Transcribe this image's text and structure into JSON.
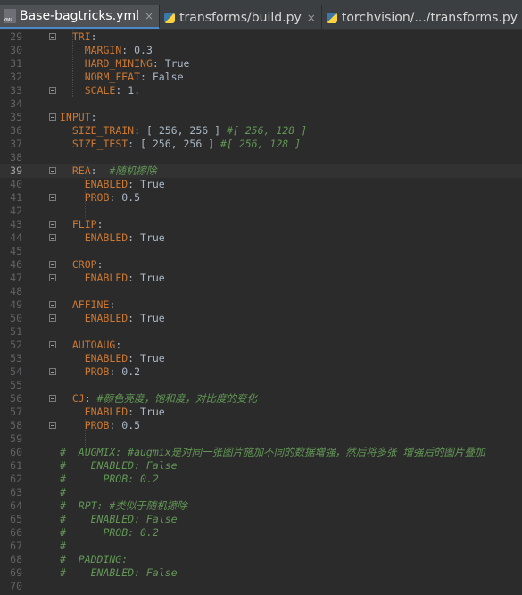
{
  "tabs": [
    {
      "label": "Base-bagtricks.yml",
      "icon": "yaml-file-icon",
      "active": true
    },
    {
      "label": "transforms/build.py",
      "icon": "python-file-icon",
      "active": false
    },
    {
      "label": "torchvision/.../transforms.py",
      "icon": "python-file-icon",
      "active": false
    }
  ],
  "close_glyph": "×",
  "editor": {
    "current_line": 39,
    "lines": [
      {
        "n": "29",
        "indent": "  ",
        "key": "TRI",
        "sep": ":",
        "val": "",
        "comment": "",
        "fold": true
      },
      {
        "n": "30",
        "indent": "    ",
        "key": "MARGIN",
        "sep": ":",
        "val": " 0.3",
        "comment": "",
        "fold": false
      },
      {
        "n": "31",
        "indent": "    ",
        "key": "HARD_MINING",
        "sep": ":",
        "val": " True",
        "comment": "",
        "fold": false
      },
      {
        "n": "32",
        "indent": "    ",
        "key": "NORM_FEAT",
        "sep": ":",
        "val": " False",
        "comment": "",
        "fold": false
      },
      {
        "n": "33",
        "indent": "    ",
        "key": "SCALE",
        "sep": ":",
        "val": " 1.",
        "comment": "",
        "fold": true
      },
      {
        "n": "34",
        "indent": "",
        "key": "",
        "sep": "",
        "val": "",
        "comment": "",
        "fold": false
      },
      {
        "n": "35",
        "indent": "",
        "key": "INPUT",
        "sep": ":",
        "val": "",
        "comment": "",
        "fold": true
      },
      {
        "n": "36",
        "indent": "  ",
        "key": "SIZE_TRAIN",
        "sep": ":",
        "val": " [ 256, 256 ] ",
        "comment": "#[ 256, 128 ]",
        "fold": false
      },
      {
        "n": "37",
        "indent": "  ",
        "key": "SIZE_TEST",
        "sep": ":",
        "val": " [ 256, 256 ] ",
        "comment": "#[ 256, 128 ]",
        "fold": false
      },
      {
        "n": "38",
        "indent": "",
        "key": "",
        "sep": "",
        "val": "",
        "comment": "",
        "fold": false
      },
      {
        "n": "39",
        "indent": "  ",
        "key": "REA",
        "sep": ":",
        "val": "  ",
        "comment": "#随机擦除",
        "fold": true
      },
      {
        "n": "40",
        "indent": "    ",
        "key": "ENABLED",
        "sep": ":",
        "val": " True",
        "comment": "",
        "fold": false
      },
      {
        "n": "41",
        "indent": "    ",
        "key": "PROB",
        "sep": ":",
        "val": " 0.5",
        "comment": "",
        "fold": true
      },
      {
        "n": "42",
        "indent": "",
        "key": "",
        "sep": "",
        "val": "",
        "comment": "",
        "fold": false
      },
      {
        "n": "43",
        "indent": "  ",
        "key": "FLIP",
        "sep": ":",
        "val": "",
        "comment": "",
        "fold": true
      },
      {
        "n": "44",
        "indent": "    ",
        "key": "ENABLED",
        "sep": ":",
        "val": " True",
        "comment": "",
        "fold": true
      },
      {
        "n": "45",
        "indent": "",
        "key": "",
        "sep": "",
        "val": "",
        "comment": "",
        "fold": false
      },
      {
        "n": "46",
        "indent": "  ",
        "key": "CROP",
        "sep": ":",
        "val": "",
        "comment": "",
        "fold": true
      },
      {
        "n": "47",
        "indent": "    ",
        "key": "ENABLED",
        "sep": ":",
        "val": " True",
        "comment": "",
        "fold": true
      },
      {
        "n": "48",
        "indent": "",
        "key": "",
        "sep": "",
        "val": "",
        "comment": "",
        "fold": false
      },
      {
        "n": "49",
        "indent": "  ",
        "key": "AFFINE",
        "sep": ":",
        "val": "",
        "comment": "",
        "fold": true
      },
      {
        "n": "50",
        "indent": "    ",
        "key": "ENABLED",
        "sep": ":",
        "val": " True",
        "comment": "",
        "fold": true
      },
      {
        "n": "51",
        "indent": "",
        "key": "",
        "sep": "",
        "val": "",
        "comment": "",
        "fold": false
      },
      {
        "n": "52",
        "indent": "  ",
        "key": "AUTOAUG",
        "sep": ":",
        "val": "",
        "comment": "",
        "fold": true
      },
      {
        "n": "53",
        "indent": "    ",
        "key": "ENABLED",
        "sep": ":",
        "val": " True",
        "comment": "",
        "fold": false
      },
      {
        "n": "54",
        "indent": "    ",
        "key": "PROB",
        "sep": ":",
        "val": " 0.2",
        "comment": "",
        "fold": true
      },
      {
        "n": "55",
        "indent": "",
        "key": "",
        "sep": "",
        "val": "",
        "comment": "",
        "fold": false
      },
      {
        "n": "56",
        "indent": "  ",
        "key": "CJ",
        "sep": ":",
        "val": " ",
        "comment": "#颜色亮度，饱和度，对比度的变化",
        "fold": true
      },
      {
        "n": "57",
        "indent": "    ",
        "key": "ENABLED",
        "sep": ":",
        "val": " True",
        "comment": "",
        "fold": false
      },
      {
        "n": "58",
        "indent": "    ",
        "key": "PROB",
        "sep": ":",
        "val": " 0.5",
        "comment": "",
        "fold": true
      },
      {
        "n": "59",
        "indent": "",
        "key": "",
        "sep": "",
        "val": "",
        "comment": "",
        "fold": false
      },
      {
        "n": "60",
        "indent": "",
        "key": "",
        "sep": "",
        "val": "",
        "comment": "#  AUGMIX: #augmix是对同一张图片施加不同的数据增强，然后将多张 增强后的图片叠加",
        "fold": false
      },
      {
        "n": "61",
        "indent": "",
        "key": "",
        "sep": "",
        "val": "",
        "comment": "#    ENABLED: False",
        "fold": false
      },
      {
        "n": "62",
        "indent": "",
        "key": "",
        "sep": "",
        "val": "",
        "comment": "#      PROB: 0.2",
        "fold": false
      },
      {
        "n": "63",
        "indent": "",
        "key": "",
        "sep": "",
        "val": "",
        "comment": "#",
        "fold": false
      },
      {
        "n": "64",
        "indent": "",
        "key": "",
        "sep": "",
        "val": "",
        "comment": "#  RPT: #类似于随机擦除",
        "fold": false
      },
      {
        "n": "65",
        "indent": "",
        "key": "",
        "sep": "",
        "val": "",
        "comment": "#    ENABLED: False",
        "fold": false
      },
      {
        "n": "66",
        "indent": "",
        "key": "",
        "sep": "",
        "val": "",
        "comment": "#      PROB: 0.2",
        "fold": false
      },
      {
        "n": "67",
        "indent": "",
        "key": "",
        "sep": "",
        "val": "",
        "comment": "#",
        "fold": false
      },
      {
        "n": "68",
        "indent": "",
        "key": "",
        "sep": "",
        "val": "",
        "comment": "#  PADDING:",
        "fold": false
      },
      {
        "n": "69",
        "indent": "",
        "key": "",
        "sep": "",
        "val": "",
        "comment": "#    ENABLED: False",
        "fold": false
      },
      {
        "n": "70",
        "indent": "",
        "key": "",
        "sep": "",
        "val": "",
        "comment": "",
        "fold": false
      }
    ]
  }
}
